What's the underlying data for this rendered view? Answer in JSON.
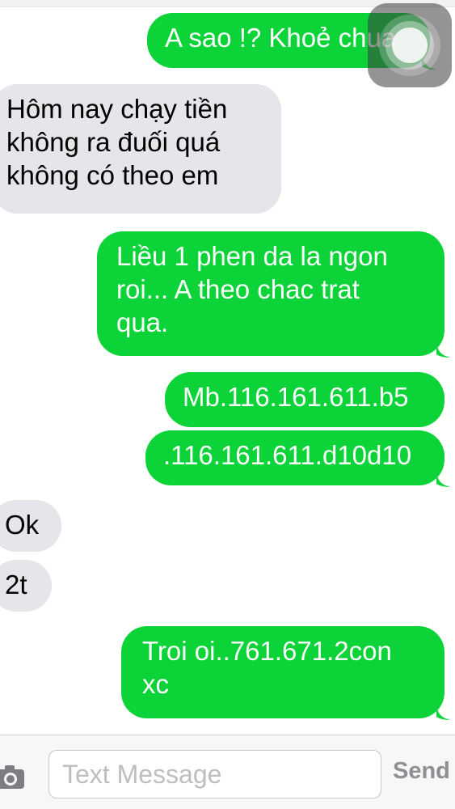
{
  "messages": [
    {
      "direction": "outgoing",
      "text": "A sao !? Khoẻ chua"
    },
    {
      "direction": "incoming",
      "lines": [
        "Hôm nay chạy tiền",
        "không ra đuối quá",
        "không có theo em"
      ]
    },
    {
      "direction": "outgoing",
      "lines": [
        "Liều 1 phen da la ngon",
        "roi... A theo chac trat",
        "qua."
      ]
    },
    {
      "direction": "outgoing",
      "text": "Mb.116.161.611.b5"
    },
    {
      "direction": "outgoing",
      "text": ".116.161.611.d10d10"
    },
    {
      "direction": "incoming",
      "text": "Ok"
    },
    {
      "direction": "incoming",
      "text": "2t"
    },
    {
      "direction": "outgoing",
      "lines": [
        "Troi oi..761.671.2con",
        "xc"
      ]
    }
  ],
  "composer": {
    "placeholder": "Text Message",
    "value": "",
    "send_label": "Send",
    "camera_icon": "camera-icon"
  },
  "overlay": {
    "assistive_touch_icon": "assistive-touch-icon"
  },
  "colors": {
    "outgoing_bubble": "#0bd338",
    "incoming_bubble": "#e5e5ea",
    "send_text": "#8e8e93"
  }
}
